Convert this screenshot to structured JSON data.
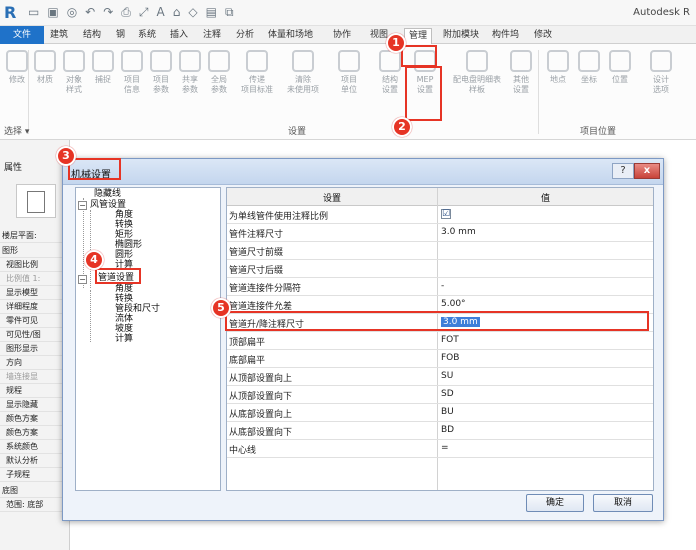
{
  "app": {
    "title": "Autodesk R",
    "logo_letter": "R"
  },
  "ribbon_tabs": [
    "文件",
    "建筑",
    "结构",
    "钢",
    "系统",
    "插入",
    "注释",
    "分析",
    "体量和场地",
    "协作",
    "视图",
    "管理",
    "附加模块",
    "构件坞",
    "修改"
  ],
  "ribbon": {
    "select_label": "选择 ▾",
    "buttons": [
      {
        "label": "修改"
      },
      {
        "label": "材质"
      },
      {
        "label": "对象\n样式"
      },
      {
        "label": "捕捉"
      },
      {
        "label": "项目\n信息"
      },
      {
        "label": "项目\n参数"
      },
      {
        "label": "共享\n参数"
      },
      {
        "label": "全局\n参数"
      },
      {
        "label": "传递\n项目标准"
      },
      {
        "label": "清除\n未使用项"
      },
      {
        "label": "项目\n单位"
      },
      {
        "label": "结构\n设置"
      },
      {
        "label": "MEP\n设置"
      },
      {
        "label": "配电盘明细表\n样板"
      },
      {
        "label": "其他\n设置"
      },
      {
        "label": "地点"
      },
      {
        "label": "坐标"
      },
      {
        "label": "位置"
      },
      {
        "label": "设计\n选项"
      }
    ],
    "groups": {
      "settings": "设置",
      "project_location": "项目位置"
    }
  },
  "properties_panel": {
    "title": "属性",
    "rows": [
      "楼层平面:",
      "图形",
      "视图比例",
      "比例值 1:",
      "显示模型",
      "详细程度",
      "零件可见",
      "可见性/图",
      "图形显示",
      "方向",
      "墙连接显",
      "规程",
      "显示隐藏",
      "颜色方案",
      "颜色方案",
      "系统颜色",
      "默认分析",
      "子规程",
      "底图",
      "范围: 底部"
    ]
  },
  "dialog": {
    "title": "机械设置",
    "help_label": "?",
    "close_label": "x",
    "tree": {
      "items": [
        {
          "label": "隐藏线"
        },
        {
          "label": "风管设置"
        },
        {
          "label": "角度"
        },
        {
          "label": "转换"
        },
        {
          "label": "矩形"
        },
        {
          "label": "椭圆形"
        },
        {
          "label": "圆形"
        },
        {
          "label": "计算"
        },
        {
          "label": "管道设置"
        },
        {
          "label": "角度"
        },
        {
          "label": "转换"
        },
        {
          "label": "管段和尺寸"
        },
        {
          "label": "流体"
        },
        {
          "label": "坡度"
        },
        {
          "label": "计算"
        }
      ]
    },
    "table": {
      "col_setting": "设置",
      "col_value": "值",
      "rows": [
        {
          "name": "为单线管件使用注释比例",
          "value": "☑"
        },
        {
          "name": "管件注释尺寸",
          "value": "3.0 mm"
        },
        {
          "name": "管道尺寸前缀",
          "value": ""
        },
        {
          "name": "管道尺寸后缀",
          "value": ""
        },
        {
          "name": "管道连接件分隔符",
          "value": "-"
        },
        {
          "name": "管道连接件允差",
          "value": "5.00°"
        },
        {
          "name": "管道升/降注释尺寸",
          "value": "3.0 mm"
        },
        {
          "name": "顶部扁平",
          "value": "FOT"
        },
        {
          "name": "底部扁平",
          "value": "FOB"
        },
        {
          "name": "从顶部设置向上",
          "value": "SU"
        },
        {
          "name": "从顶部设置向下",
          "value": "SD"
        },
        {
          "name": "从底部设置向上",
          "value": "BU"
        },
        {
          "name": "从底部设置向下",
          "value": "BD"
        },
        {
          "name": "中心线",
          "value": "="
        }
      ]
    },
    "ok_label": "确定",
    "cancel_label": "取消"
  },
  "callouts": [
    "1",
    "2",
    "3",
    "4",
    "5"
  ],
  "colors": {
    "accent_red": "#e63425",
    "file_tab_blue": "#1f72c9",
    "selection_blue": "#3d7fd9"
  }
}
